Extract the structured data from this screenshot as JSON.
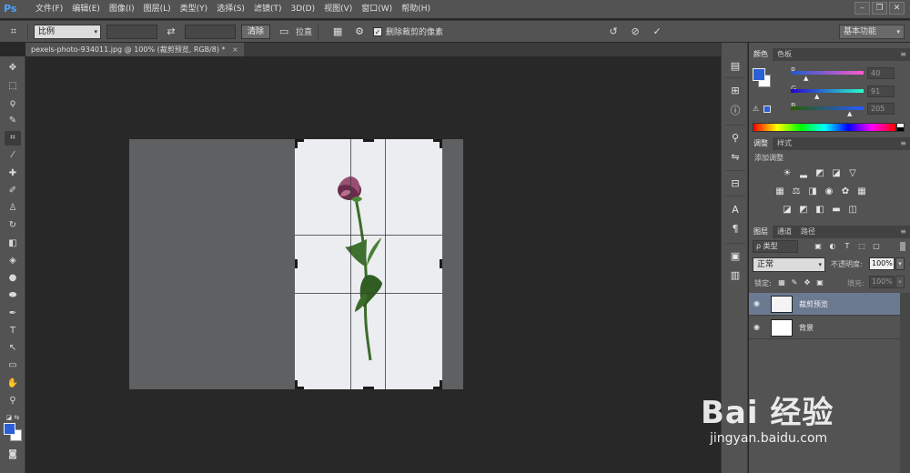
{
  "app": {
    "logo": "Ps"
  },
  "menu": [
    "文件(F)",
    "编辑(E)",
    "图像(I)",
    "图层(L)",
    "类型(Y)",
    "选择(S)",
    "滤镜(T)",
    "3D(D)",
    "视图(V)",
    "窗口(W)",
    "帮助(H)"
  ],
  "window_controls": {
    "minimize": "–",
    "restore": "❐",
    "close": "✕"
  },
  "options_bar": {
    "ratio_select": "比例",
    "clear_button": "清除",
    "straighten_label": "拉直",
    "delete_cropped_label": "删除裁剪的像素",
    "delete_cropped_checked": true,
    "workspace": "基本功能"
  },
  "document": {
    "tab_title": "pexels-photo-934011.jpg @ 100% (裁剪预览, RGB/8) *",
    "tab_close": "×"
  },
  "colors": {
    "foreground": "#2a5fd6",
    "background": "#ffffff",
    "accent": "#6b7a91"
  },
  "color_panel": {
    "tabs": [
      "颜色",
      "色板"
    ],
    "r": {
      "label": "R",
      "value": "40"
    },
    "g": {
      "label": "G",
      "value": "91"
    },
    "b": {
      "label": "B",
      "value": "205"
    }
  },
  "adjustments_panel": {
    "tabs": [
      "调整",
      "样式"
    ],
    "title": "添加调整"
  },
  "layers_panel": {
    "tabs": [
      "图层",
      "通道",
      "路径"
    ],
    "filter_label": "ρ 类型",
    "blend_mode": "正常",
    "opacity_label": "不透明度:",
    "opacity_value": "100%",
    "lock_label": "锁定:",
    "fill_label": "填充:",
    "fill_value": "100%",
    "layers": [
      {
        "name": "裁剪预览",
        "selected": true
      },
      {
        "name": "背景",
        "selected": false
      }
    ]
  },
  "watermark": {
    "logo": "Bai 经验",
    "url": "jingyan.baidu.com"
  }
}
